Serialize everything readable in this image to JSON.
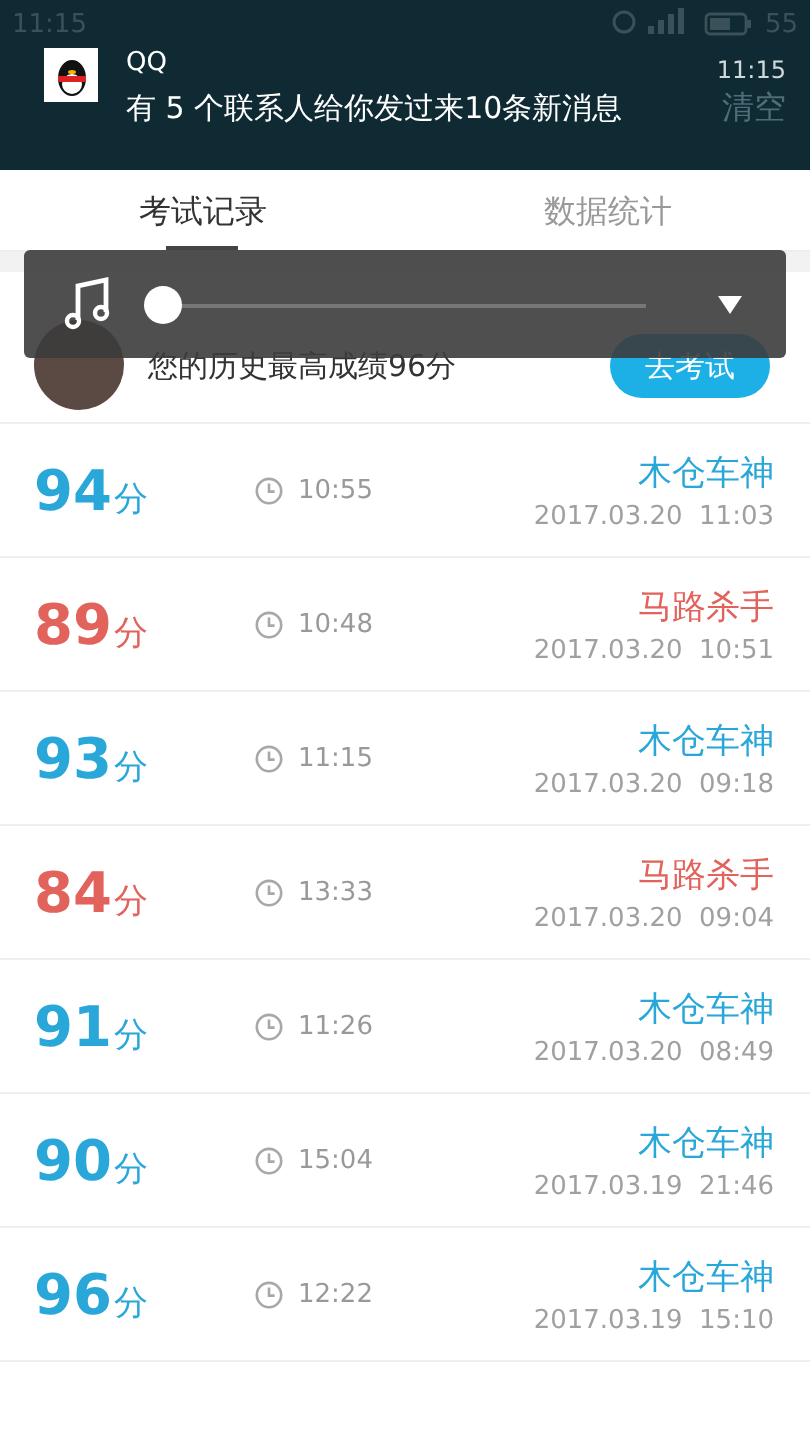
{
  "status_bar": {
    "time": "11:15",
    "battery": "55"
  },
  "notification": {
    "app": "QQ",
    "message": "有 5 个联系人给你发过来10条新消息",
    "time": "11:15",
    "action": "清空"
  },
  "tabs": [
    {
      "label": "考试记录",
      "selected": true
    },
    {
      "label": "数据统计",
      "selected": false
    }
  ],
  "player": {
    "level": 0
  },
  "best": {
    "text": "您的历史最高成绩96分",
    "button": "去考试"
  },
  "records": [
    {
      "score": "94",
      "unit": "分",
      "duration": "10:55",
      "title": "木仓车神",
      "date": "2017.03.20  11:03",
      "color": "#2aa7d9"
    },
    {
      "score": "89",
      "unit": "分",
      "duration": "10:48",
      "title": "马路杀手",
      "date": "2017.03.20  10:51",
      "color": "#e2625c"
    },
    {
      "score": "93",
      "unit": "分",
      "duration": "11:15",
      "title": "木仓车神",
      "date": "2017.03.20  09:18",
      "color": "#2aa7d9"
    },
    {
      "score": "84",
      "unit": "分",
      "duration": "13:33",
      "title": "马路杀手",
      "date": "2017.03.20  09:04",
      "color": "#e2625c"
    },
    {
      "score": "91",
      "unit": "分",
      "duration": "11:26",
      "title": "木仓车神",
      "date": "2017.03.20  08:49",
      "color": "#2aa7d9"
    },
    {
      "score": "90",
      "unit": "分",
      "duration": "15:04",
      "title": "木仓车神",
      "date": "2017.03.19  21:46",
      "color": "#2aa7d9"
    },
    {
      "score": "96",
      "unit": "分",
      "duration": "12:22",
      "title": "木仓车神",
      "date": "2017.03.19  15:10",
      "color": "#2aa7d9"
    }
  ]
}
